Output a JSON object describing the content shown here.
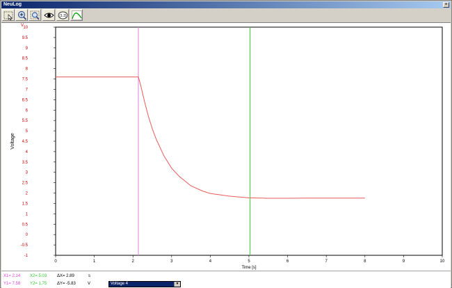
{
  "window": {
    "title": "NeuLog"
  },
  "toolbar": {
    "tools": [
      {
        "name": "select-tool-button",
        "icon": "arrow-select-icon"
      },
      {
        "name": "zoom-in-button",
        "icon": "magnifier-plus-icon"
      },
      {
        "name": "zoom-fit-button",
        "icon": "magnifier-fit-icon"
      },
      {
        "name": "view-button",
        "icon": "eye-icon"
      },
      {
        "name": "show-values-button",
        "icon": "value-marker-icon",
        "label": "(1.3)"
      },
      {
        "name": "curve-fit-button",
        "icon": "curve-icon"
      }
    ]
  },
  "chart_data": {
    "type": "line",
    "xlabel": "Time [s]",
    "ylabel": "Voltage",
    "yunit": "V",
    "xlim": [
      0,
      10
    ],
    "ylim": [
      -1,
      10
    ],
    "xticks": [
      "0",
      "1",
      "2",
      "3",
      "4",
      "5",
      "6",
      "7",
      "8",
      "9",
      "10"
    ],
    "yticks": [
      "-1",
      "-0.5",
      "0",
      "0.5",
      "1",
      "1.5",
      "2",
      "2.5",
      "3",
      "3.5",
      "4",
      "4.5",
      "5",
      "5.5",
      "6",
      "6.5",
      "7",
      "7.5",
      "8",
      "8.5",
      "9",
      "9.5",
      "10"
    ],
    "series": [
      {
        "color": "#e85a5a",
        "x": [
          0,
          2.14,
          2.2,
          2.3,
          2.4,
          2.5,
          2.6,
          2.8,
          3.0,
          3.2,
          3.5,
          3.8,
          4.0,
          4.5,
          5.0,
          5.5,
          6.0,
          6.5,
          7.0,
          7.5,
          8.0
        ],
        "y": [
          7.6,
          7.6,
          7.2,
          6.4,
          5.7,
          5.1,
          4.6,
          3.8,
          3.2,
          2.8,
          2.35,
          2.1,
          1.98,
          1.85,
          1.77,
          1.75,
          1.75,
          1.76,
          1.76,
          1.76,
          1.76
        ]
      }
    ],
    "cursors": [
      {
        "x": 2.14,
        "color": "#e080e0"
      },
      {
        "x": 5.03,
        "color": "#33cc33"
      }
    ],
    "grid": false
  },
  "status": {
    "x1": "X1= 2.14",
    "y1": "Y1= 7.58",
    "x2": "X2= 5.03",
    "y2": "Y2= 1.75",
    "dx": "ΔX= 2.89",
    "dy": "ΔY= -5.83",
    "x_unit": "s",
    "y_unit": "V",
    "sensor_selected": "Voltage  4",
    "colors": {
      "cursor1": "#e040e0",
      "cursor2": "#33cc33"
    }
  }
}
